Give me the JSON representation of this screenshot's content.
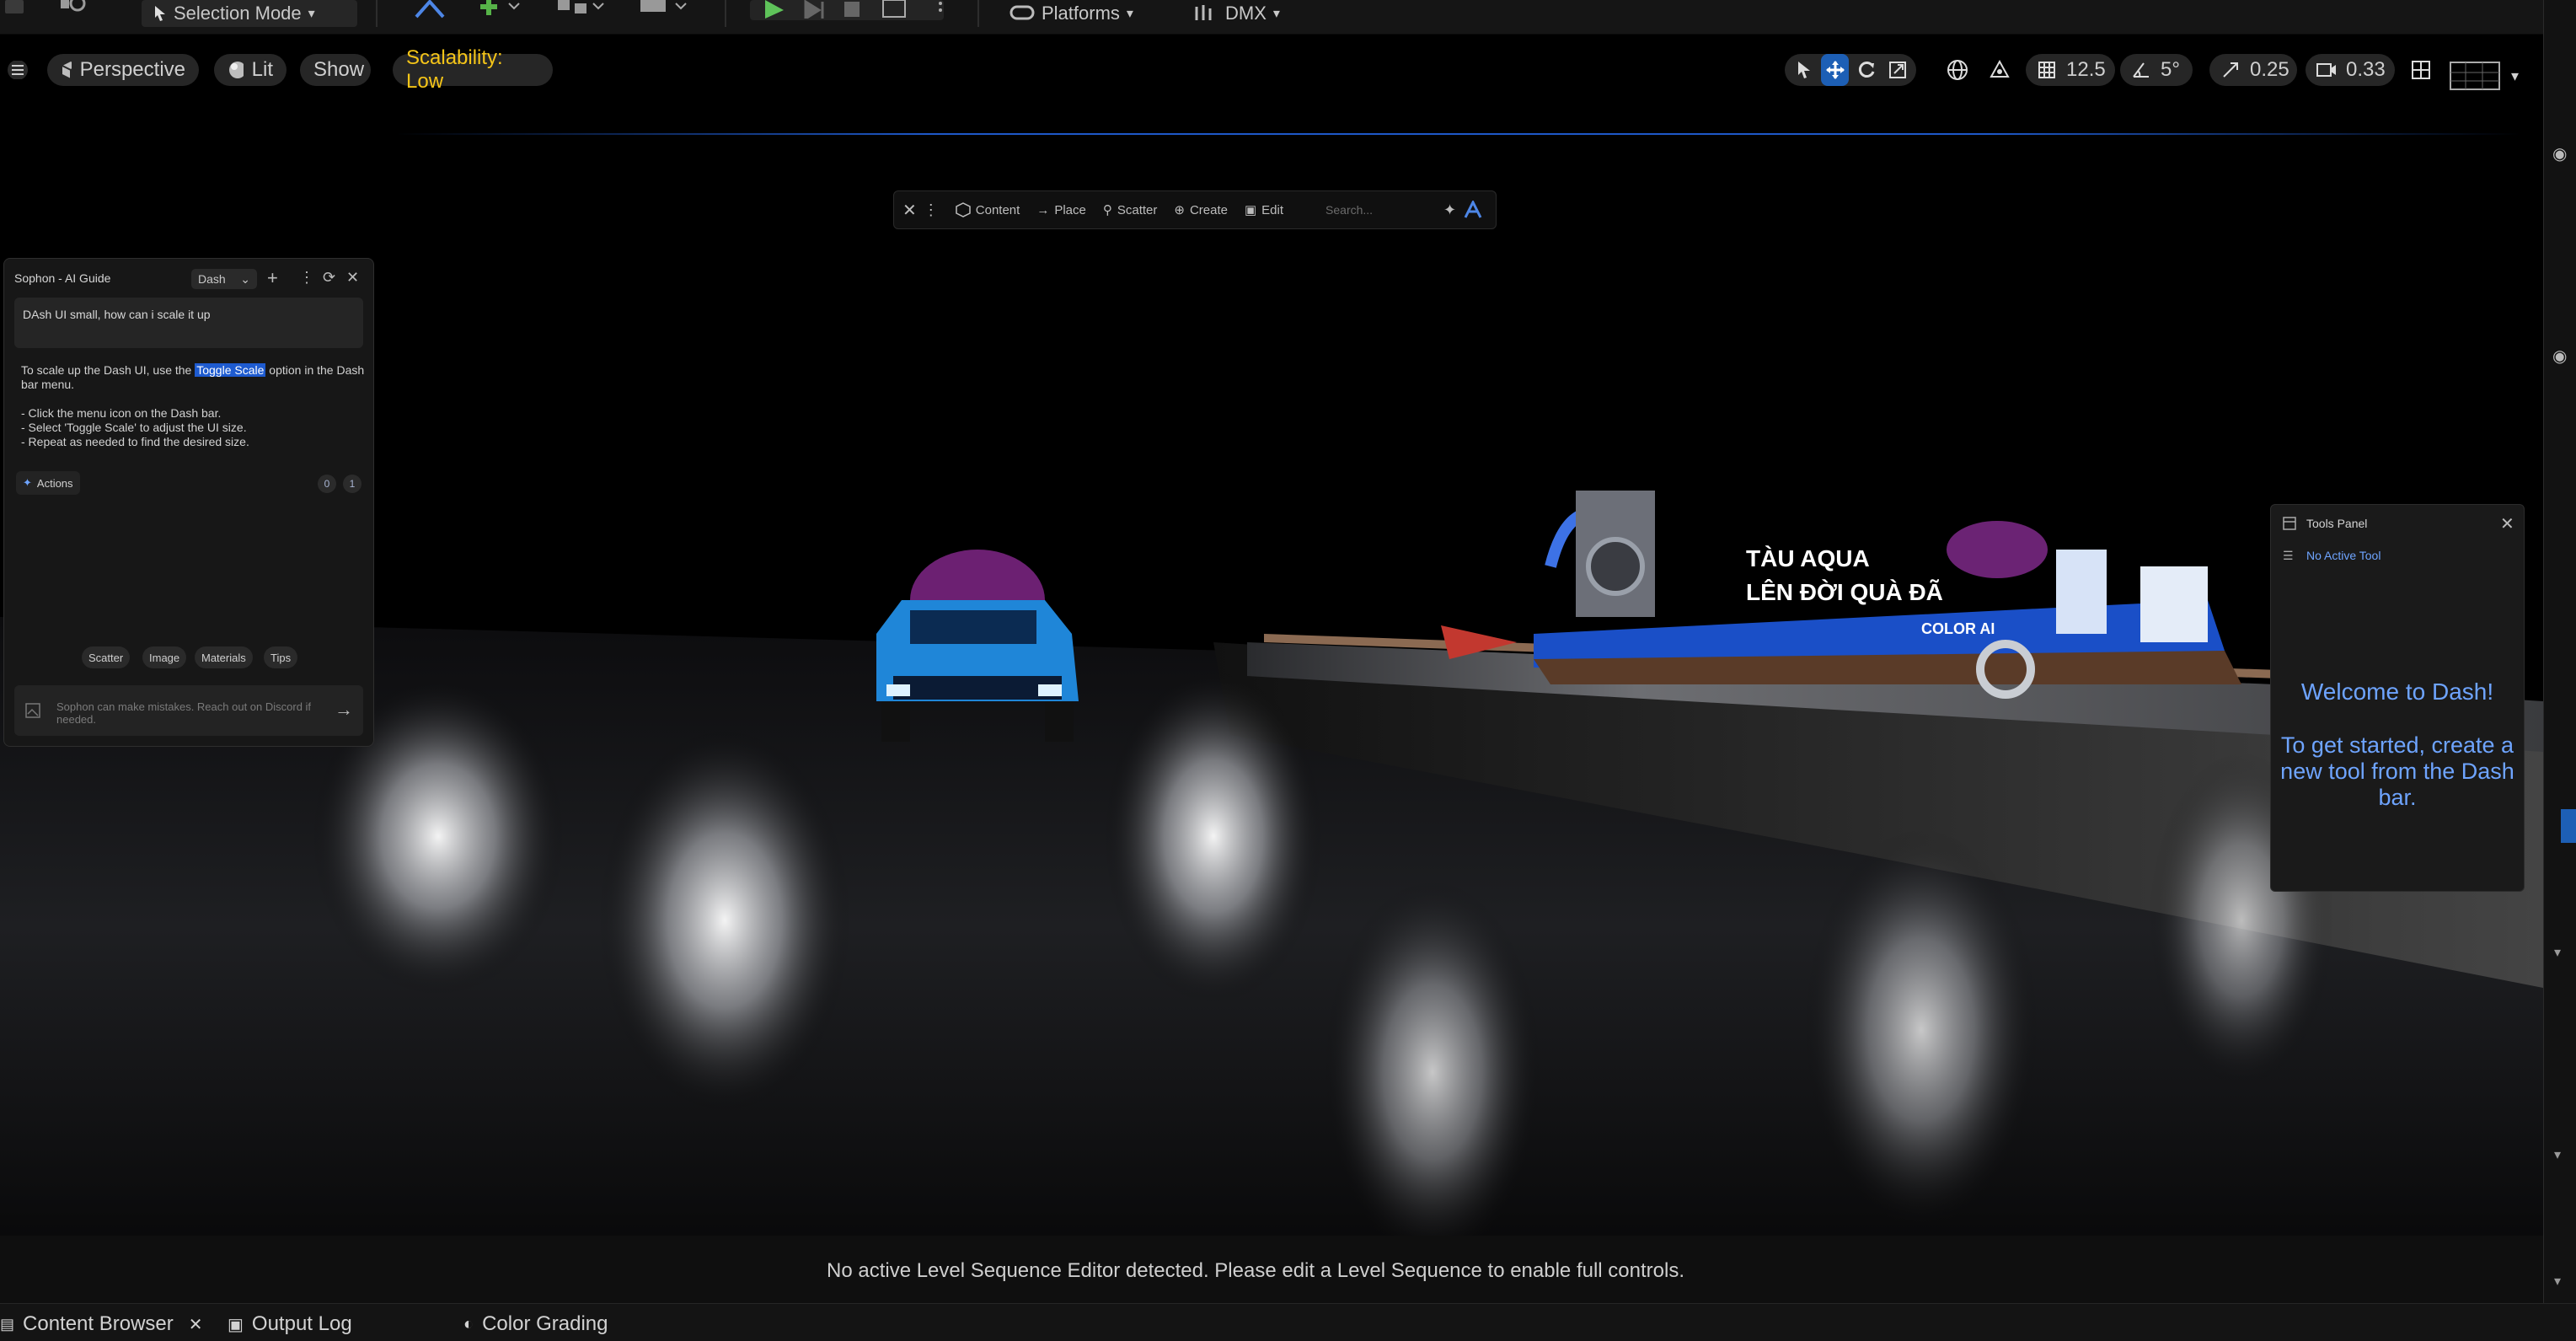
{
  "top_toolbar": {
    "selection_mode": "Selection Mode",
    "platforms": "Platforms",
    "dmx": "DMX"
  },
  "viewport_toolbar": {
    "perspective": "Perspective",
    "lit": "Lit",
    "show": "Show",
    "scalability": "Scalability: Low",
    "grid_snap": "12.5",
    "rotation_snap": "5°",
    "scale_snap": "0.25",
    "camera_speed": "0.33"
  },
  "dash_bar": {
    "content": "Content",
    "place": "Place",
    "scatter": "Scatter",
    "create": "Create",
    "edit": "Edit",
    "search_placeholder": "Search..."
  },
  "sophon": {
    "title": "Sophon - AI Guide",
    "mode": "Dash",
    "question": "DAsh UI small, how can i scale it up",
    "answer_pre": "To scale up the Dash UI, use the ",
    "answer_highlight": "Toggle Scale",
    "answer_post": " option in the Dash bar menu.",
    "steps": [
      "- Click the menu icon on the Dash bar.",
      "- Select 'Toggle Scale' to adjust the UI size.",
      "- Repeat as needed to find the desired size."
    ],
    "actions_label": "Actions",
    "badge_a": "0",
    "badge_b": "1",
    "chips": [
      "Scatter",
      "Image",
      "Materials",
      "Tips"
    ],
    "input_placeholder": "Sophon can make mistakes. Reach out on Discord if needed."
  },
  "tools_panel": {
    "title": "Tools Panel",
    "no_active": "No Active Tool",
    "welcome": "Welcome to Dash!",
    "get_started": "To get started, create a new tool from the Dash bar."
  },
  "sequence_bar": {
    "message": "No active Level Sequence Editor detected. Please edit a Level Sequence to enable full controls."
  },
  "bottom_tabs": {
    "content_browser": "Content Browser",
    "output_log": "Output Log",
    "color_grading": "Color Grading"
  },
  "scene": {
    "billboard_line1": "TÀU AQUA",
    "billboard_line2": "LÊN ĐỜI QUÀ ĐÃ",
    "brand": "COLOR AI"
  },
  "colors": {
    "accent": "#1d5fb5",
    "dash_text": "#6ea4ff",
    "scalability": "#f5c518"
  }
}
